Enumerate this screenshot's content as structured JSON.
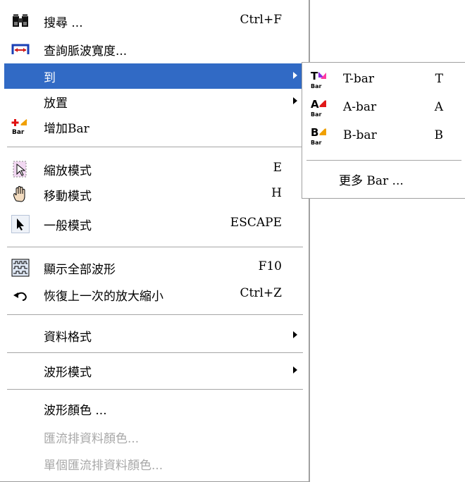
{
  "main_menu": {
    "search": {
      "label": "搜尋 ...",
      "shortcut": "Ctrl+F",
      "icon": "binoculars-icon"
    },
    "pulse": {
      "label": "查詢脈波寬度...",
      "icon": "pulse-width-icon"
    },
    "goto": {
      "label": "到",
      "icon": ""
    },
    "place": {
      "label": "放置"
    },
    "add_bar": {
      "label": "增加Bar",
      "icon": "add-bar-icon"
    },
    "zoom_mode": {
      "label": "縮放模式",
      "shortcut": "E",
      "icon": "zoom-icon"
    },
    "move_mode": {
      "label": "移動模式",
      "shortcut": "H",
      "icon": "hand-icon"
    },
    "normal_mode": {
      "label": "一般模式",
      "shortcut": "ESCAPE",
      "icon": "arrow-cursor-icon"
    },
    "show_all": {
      "label": "顯示全部波形",
      "shortcut": "F10",
      "icon": "waveform-icon"
    },
    "undo_zoom": {
      "label": "恢復上一次的放大縮小",
      "shortcut": "Ctrl+Z",
      "icon": "undo-icon"
    },
    "data_format": {
      "label": "資料格式"
    },
    "wave_mode": {
      "label": "波形模式"
    },
    "wave_color": {
      "label": "波形顏色 ..."
    },
    "bus_color": {
      "label": "匯流排資料顏色..."
    },
    "single_bus_color": {
      "label": "單個匯流排資料顏色..."
    }
  },
  "sub_menu": {
    "t_bar": {
      "label": "T-bar",
      "shortcut": "T",
      "icon_letter": "T"
    },
    "a_bar": {
      "label": "A-bar",
      "shortcut": "A",
      "icon_letter": "A"
    },
    "b_bar": {
      "label": "B-bar",
      "shortcut": "B",
      "icon_letter": "B"
    },
    "bar_tag": "Bar",
    "more": {
      "label": "更多 Bar ..."
    }
  },
  "colors": {
    "highlight": "#316ac5",
    "disabled": "#a8a8a8"
  }
}
